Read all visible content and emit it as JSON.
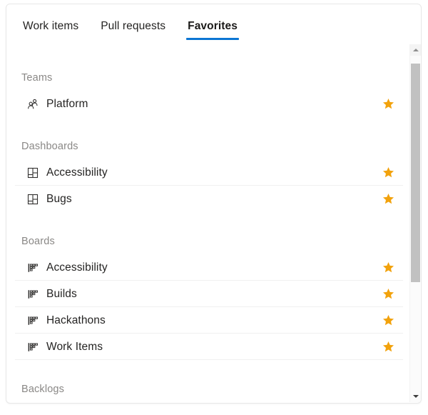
{
  "tabs": [
    {
      "label": "Work items",
      "selected": false
    },
    {
      "label": "Pull requests",
      "selected": false
    },
    {
      "label": "Favorites",
      "selected": true
    }
  ],
  "colors": {
    "accent": "#0c76d3",
    "star": "#f2a20c",
    "section_header": "#8a8886",
    "text": "#252423",
    "divider": "#f0f0f0",
    "scrollbar_thumb": "#c1c1c1"
  },
  "sections": [
    {
      "title": "Teams",
      "items": [
        {
          "label": "Platform",
          "icon": "team-members-icon",
          "favorited": true,
          "star_icon": "star-filled-icon"
        }
      ]
    },
    {
      "title": "Dashboards",
      "items": [
        {
          "label": "Accessibility",
          "icon": "dashboard-icon",
          "favorited": true,
          "star_icon": "star-filled-icon"
        },
        {
          "label": "Bugs",
          "icon": "dashboard-icon",
          "favorited": true,
          "star_icon": "star-filled-icon"
        }
      ]
    },
    {
      "title": "Boards",
      "items": [
        {
          "label": "Accessibility",
          "icon": "board-icon",
          "favorited": true,
          "star_icon": "star-filled-icon"
        },
        {
          "label": "Builds",
          "icon": "board-icon",
          "favorited": true,
          "star_icon": "star-filled-icon"
        },
        {
          "label": "Hackathons",
          "icon": "board-icon",
          "favorited": true,
          "star_icon": "star-filled-icon"
        },
        {
          "label": "Work Items",
          "icon": "board-icon",
          "favorited": true,
          "star_icon": "star-filled-icon"
        }
      ]
    },
    {
      "title": "Backlogs",
      "items": []
    }
  ],
  "scrollbar": {
    "up_icon": "scroll-up-arrow-icon",
    "down_icon": "scroll-down-arrow-icon",
    "thumb": "scrollbar-thumb"
  }
}
